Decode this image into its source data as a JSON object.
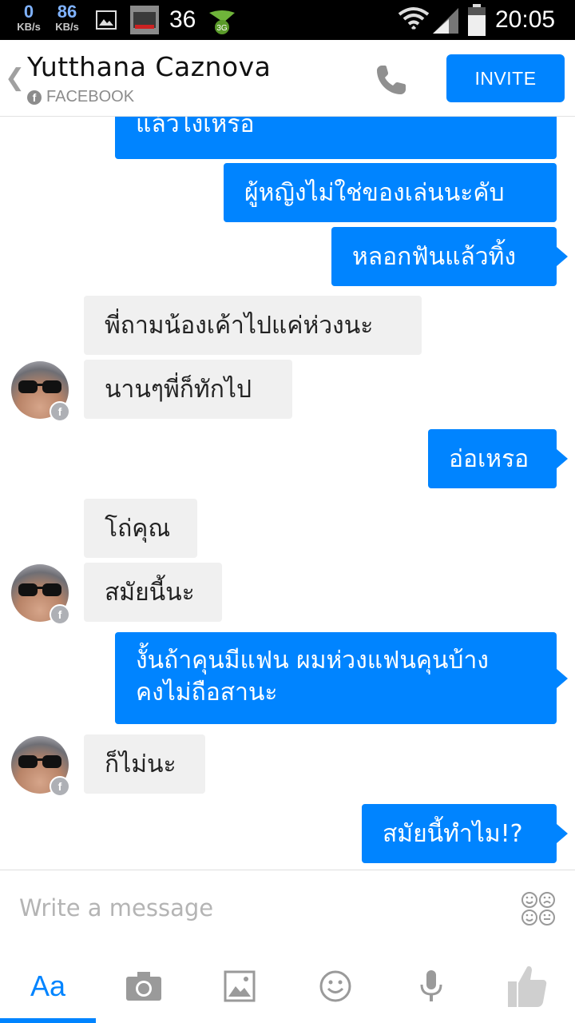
{
  "status_bar": {
    "down_value": "0",
    "down_unit": "KB/s",
    "up_value": "86",
    "up_unit": "KB/s",
    "notification_count": "36",
    "time": "20:05"
  },
  "header": {
    "contact_name": "Yutthana Caznova",
    "source": "FACEBOOK",
    "invite_label": "INVITE"
  },
  "messages": [
    {
      "dir": "out",
      "text": "แล้วไงเหรอ"
    },
    {
      "dir": "out",
      "text": "ผู้หญิงไม่ใช่ของเล่นนะคับ"
    },
    {
      "dir": "out",
      "text": "หลอกฟันแล้วทิ้ง"
    },
    {
      "dir": "in",
      "text": "พี่ถามน้องเค้าไปแค่ห่วงนะ"
    },
    {
      "dir": "in",
      "text": "นานๆพี่ก็ทักไป"
    },
    {
      "dir": "out",
      "text": "อ่อเหรอ"
    },
    {
      "dir": "in",
      "text": "โถ่คุณ"
    },
    {
      "dir": "in",
      "text": "สมัยนี้นะ"
    },
    {
      "dir": "out",
      "text": "งั้นถ้าคุนมีแฟน ผมห่วงแฟนคุนบ้าง",
      "text2": "คงไม่ถือสานะ"
    },
    {
      "dir": "in",
      "text": "ก็ไม่นะ"
    },
    {
      "dir": "out",
      "text": "สมัยนี้ทำไม!?"
    }
  ],
  "composer": {
    "placeholder": "Write a message"
  },
  "toolbar": {
    "text_tab_label": "Aa"
  },
  "colors": {
    "accent": "#0084ff",
    "incoming_bubble": "#f0f0f0",
    "status_bar": "#000000"
  },
  "icons": [
    "back-chevron-icon",
    "facebook-icon",
    "phone-icon",
    "emoticons-icon",
    "camera-icon",
    "gallery-icon",
    "smiley-icon",
    "microphone-icon",
    "thumbs-up-icon"
  ]
}
